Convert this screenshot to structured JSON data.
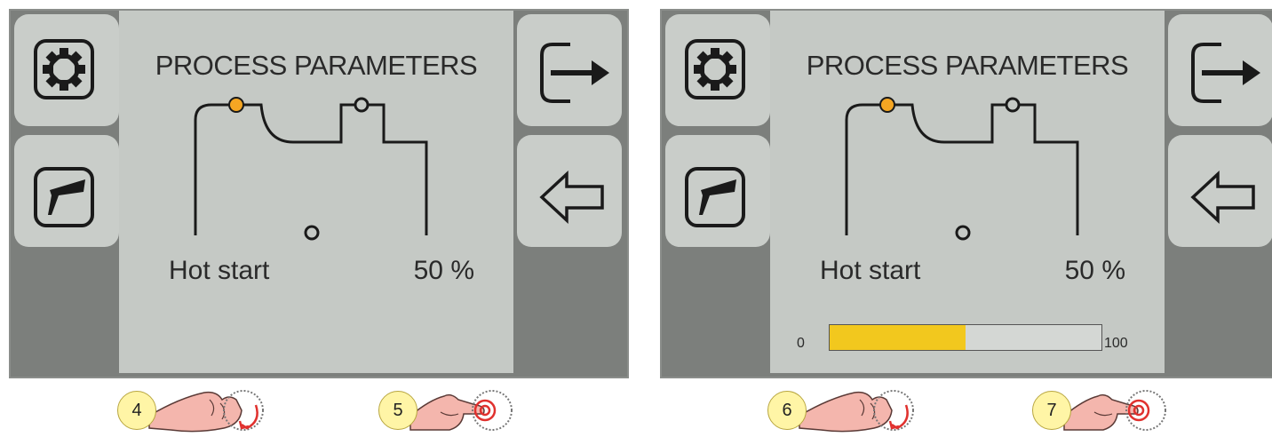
{
  "panels": [
    {
      "title": "PROCESS PARAMETERS",
      "parameter_name": "Hot start",
      "parameter_value": "50 %",
      "show_bar": false
    },
    {
      "title": "PROCESS PARAMETERS",
      "parameter_name": "Hot start",
      "parameter_value": "50 %",
      "show_bar": true,
      "bar": {
        "min": "0",
        "max": "100",
        "level": 0.5,
        "fill_color": "#f2c81e"
      }
    }
  ],
  "icons": {
    "left_top": "gear-icon",
    "left_mid": "welding-torch-icon",
    "right_top": "exit-arrow-icon",
    "right_mid": "back-arrow-icon",
    "active_point_color": "#f5a623"
  },
  "steps": [
    {
      "number": "4",
      "action": "turn-knob"
    },
    {
      "number": "5",
      "action": "press-knob"
    },
    {
      "number": "6",
      "action": "turn-knob"
    },
    {
      "number": "7",
      "action": "press-knob"
    }
  ]
}
